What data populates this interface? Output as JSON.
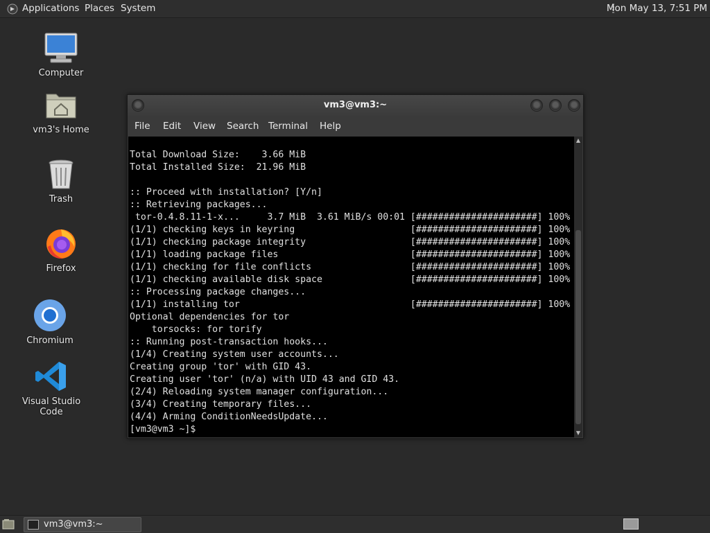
{
  "top_panel": {
    "applications": "Applications",
    "places": "Places",
    "system": "System",
    "clock": "Mon May 13,  7:51 PM"
  },
  "desktop_icons": {
    "computer": "Computer",
    "home": "vm3's Home",
    "trash": "Trash",
    "firefox": "Firefox",
    "chromium": "Chromium",
    "vscode": "Visual Studio Code"
  },
  "terminal": {
    "title": "vm3@vm3:~",
    "menu": [
      "File",
      "Edit",
      "View",
      "Search",
      "Terminal",
      "Help"
    ],
    "output": "Total Download Size:    3.66 MiB\nTotal Installed Size:  21.96 MiB\n\n:: Proceed with installation? [Y/n]\n:: Retrieving packages...\n tor-0.4.8.11-1-x...     3.7 MiB  3.61 MiB/s 00:01 [######################] 100%\n(1/1) checking keys in keyring                     [######################] 100%\n(1/1) checking package integrity                   [######################] 100%\n(1/1) loading package files                        [######################] 100%\n(1/1) checking for file conflicts                  [######################] 100%\n(1/1) checking available disk space                [######################] 100%\n:: Processing package changes...\n(1/1) installing tor                               [######################] 100%\nOptional dependencies for tor\n    torsocks: for torify\n:: Running post-transaction hooks...\n(1/4) Creating system user accounts...\nCreating group 'tor' with GID 43.\nCreating user 'tor' (n/a) with UID 43 and GID 43.\n(2/4) Reloading system manager configuration...\n(3/4) Creating temporary files...\n(4/4) Arming ConditionNeedsUpdate...\n[vm3@vm3 ~]$ "
  },
  "taskbar": {
    "task_label": "vm3@vm3:~"
  },
  "icons": {
    "apps_menu": "gnome-foot-icon",
    "show_desktop": "show-desktop-icon",
    "workspace": "workspace-switcher-icon"
  },
  "colors": {
    "desktop_bg": "#2a2a2a",
    "panel_bg": "#2e2e2e",
    "terminal_bg": "#000000",
    "terminal_fg": "#e0e0e0"
  }
}
